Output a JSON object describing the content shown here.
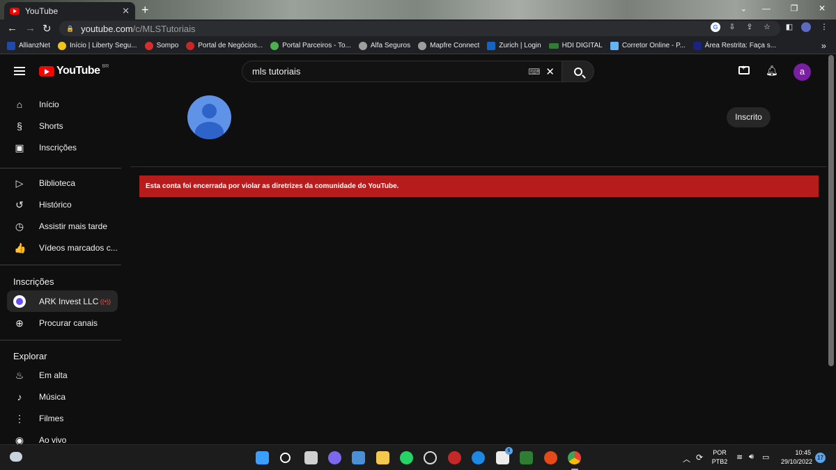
{
  "browser": {
    "tab_title": "YouTube",
    "tab_close": "✕",
    "new_tab": "+",
    "url_host": "youtube.com",
    "url_path": "/c/MLSTutoriais",
    "bookmarks": [
      {
        "label": "AllianzNet",
        "color": "#1f4aa8"
      },
      {
        "label": "Início | Liberty Segu...",
        "color": "#f2c318"
      },
      {
        "label": "Sompo",
        "color": "#d32f2f"
      },
      {
        "label": "Portal de Negócios...",
        "color": "#c62828"
      },
      {
        "label": "Portal Parceiros - To...",
        "color": "#4caf50"
      },
      {
        "label": "Alfa Seguros",
        "color": "#9e9e9e"
      },
      {
        "label": "Mapfre Connect",
        "color": "#9e9e9e"
      },
      {
        "label": "Zurich | Login",
        "color": "#1565c0"
      },
      {
        "label": "HDI DIGITAL",
        "color": "#2e7d32"
      },
      {
        "label": "Corretor Online - P...",
        "color": "#64b5f6"
      },
      {
        "label": "Área Restrita: Faça s...",
        "color": "#1a237e"
      }
    ],
    "bookmarks_more": "»"
  },
  "masthead": {
    "logo_text": "YouTube",
    "country_code": "BR",
    "search_value": "mls tutoriais",
    "avatar_letter": "a"
  },
  "sidebar": {
    "main": [
      {
        "label": "Início",
        "icon": "home-icon",
        "glyph": "⌂"
      },
      {
        "label": "Shorts",
        "icon": "shorts-icon",
        "glyph": "§"
      },
      {
        "label": "Inscrições",
        "icon": "subscriptions-icon",
        "glyph": "▣"
      }
    ],
    "library": [
      {
        "label": "Biblioteca",
        "icon": "library-icon",
        "glyph": "▷"
      },
      {
        "label": "Histórico",
        "icon": "history-icon",
        "glyph": "↺"
      },
      {
        "label": "Assistir mais tarde",
        "icon": "watch-later-icon",
        "glyph": "◷"
      },
      {
        "label": "Vídeos marcados c...",
        "icon": "liked-videos-icon",
        "glyph": "👍"
      }
    ],
    "subscriptions_title": "Inscrições",
    "subscriptions": [
      {
        "label": "ARK Invest LLC",
        "live": "((•))"
      },
      {
        "label": "Procurar canais",
        "glyph": "⊕"
      }
    ],
    "explore_title": "Explorar",
    "explore": [
      {
        "label": "Em alta",
        "icon": "trending-icon",
        "glyph": "♨"
      },
      {
        "label": "Música",
        "icon": "music-icon",
        "glyph": "♪"
      },
      {
        "label": "Filmes",
        "icon": "movies-icon",
        "glyph": "⋮"
      },
      {
        "label": "Ao vivo",
        "icon": "live-icon",
        "glyph": "◉"
      }
    ]
  },
  "channel": {
    "subscribe_label": "Inscrito",
    "terminated_message": "Esta conta foi encerrada por violar as diretrizes da comunidade do YouTube."
  },
  "taskbar": {
    "language": "POR",
    "layout": "PTB2",
    "time": "10:45",
    "date": "29/10/2022",
    "notifications": "17",
    "store_badge": "6"
  }
}
